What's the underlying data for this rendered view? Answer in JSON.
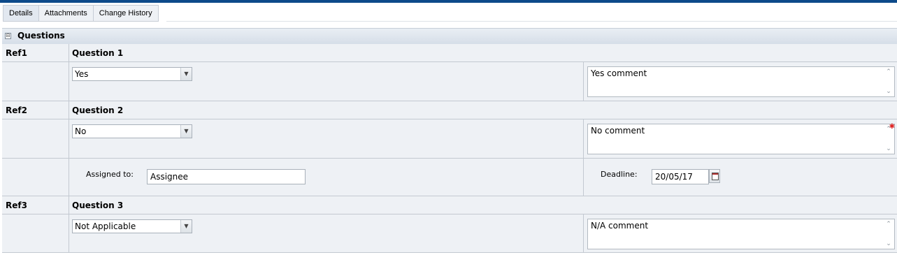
{
  "tabs": [
    "Details",
    "Attachments",
    "Change History"
  ],
  "section": {
    "title": "Questions",
    "collapse_symbol": "⊟"
  },
  "questions": [
    {
      "ref": "Ref1",
      "title": "Question 1",
      "answer": "Yes",
      "comment": "Yes comment",
      "required": false
    },
    {
      "ref": "Ref2",
      "title": "Question 2",
      "answer": "No",
      "comment": "No comment",
      "required": true
    },
    {
      "ref": "Ref3",
      "title": "Question 3",
      "answer": "Not Applicable",
      "comment": "N/A comment",
      "required": false
    }
  ],
  "action": {
    "assigned_label": "Assigned to:",
    "assigned_value": "Assignee",
    "deadline_label": "Deadline:",
    "deadline_value": "20/05/17"
  },
  "glyphs": {
    "dropdown": "▼",
    "scroll_up": "⌃",
    "scroll_down": "⌄",
    "required": "✱"
  },
  "colors": {
    "topbar": "#0d4a8a",
    "required": "#dd2222"
  }
}
